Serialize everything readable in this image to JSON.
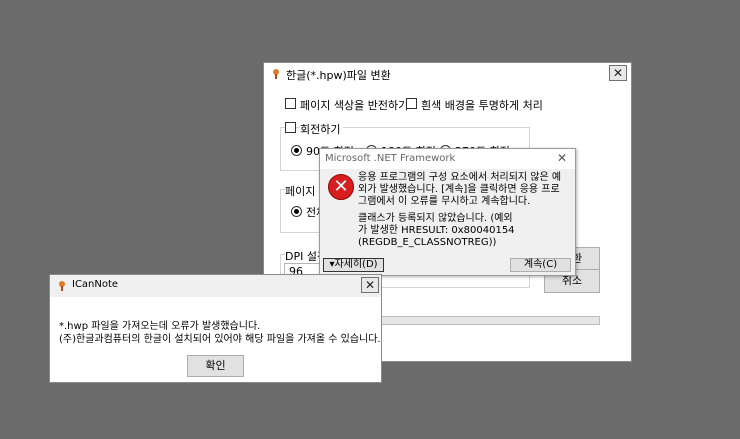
{
  "convert_dialog": {
    "title": "한글(*.hpw)파일 변환",
    "close_glyph": "✕",
    "invert_page_color": "페이지 색상을 반전하기",
    "transparent_white_bg": "흰색 배경을 투명하게 처리",
    "rotate": "회전하기",
    "rotate_90": "90도 회전",
    "rotate_180": "180도 회전",
    "rotate_270": "270도 회전",
    "page_range_label": "페이지 지정",
    "page_all": "전체",
    "dpi_label": "DPI 설정",
    "dpi_value": "96",
    "convert_button": "변환",
    "cancel_button": "취소"
  },
  "net_dialog": {
    "title": "Microsoft .NET Framework",
    "close_glyph": "✕",
    "message_1": "응용 프로그램의 구성 요소에서 처리되지 않은 예외가 발생했습니다. [계속]을 클릭하면 응용 프로그램에서 이 오류를 무시하고 계속합니다.",
    "message_2": "클래스가 등록되지 않았습니다. (예외가 발생한 HRESULT: 0x80040154 (REGDB_E_CLASSNOTREG))",
    "details_button": "▾자세히(D)",
    "continue_button": "계속(C)"
  },
  "icannote_dialog": {
    "title": "ICanNote",
    "close_glyph": "✕",
    "line_1": "*.hwp 파일을 가져오는데 오류가 발생했습니다.",
    "line_2": "(주)한글과컴퓨터의 한글이 설치되어 있어야 해당 파일을 가져올 수 있습니다.",
    "ok_button": "확인"
  },
  "colors": {
    "desktop": "#6b6b6b",
    "window_bg": "#ffffff",
    "titlebar": "#f0f0f0",
    "error_icon": "#d81e1e"
  }
}
